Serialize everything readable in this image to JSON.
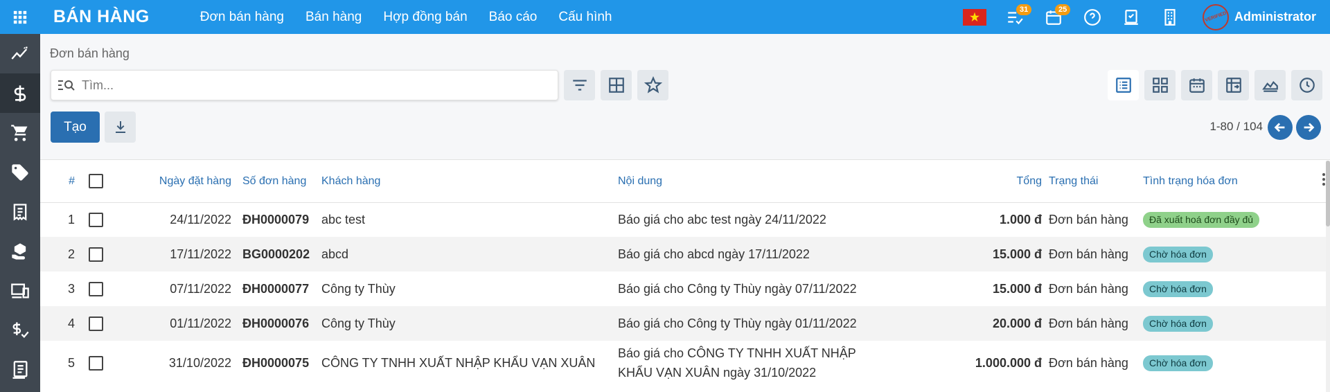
{
  "app": {
    "title": "BÁN HÀNG",
    "menu": [
      "Đơn bán hàng",
      "Bán hàng",
      "Hợp đồng bán",
      "Báo cáo",
      "Cấu hình"
    ],
    "activities_badge": "31",
    "calendar_badge": "25",
    "stamp_text": "VERIFIED",
    "user": "Administrator"
  },
  "control": {
    "breadcrumb": "Đơn bán hàng",
    "search_placeholder": "Tìm...",
    "create_label": "Tạo",
    "pager": "1-80 / 104"
  },
  "table": {
    "headers": {
      "num": "#",
      "date": "Ngày đặt hàng",
      "so": "Số đơn hàng",
      "customer": "Khách hàng",
      "content": "Nội dung",
      "total": "Tổng",
      "status": "Trạng thái",
      "invoice": "Tình trạng hóa đơn"
    },
    "rows": [
      {
        "num": "1",
        "date": "24/11/2022",
        "so": "ĐH0000079",
        "customer": "abc test",
        "content": "Báo giá cho abc test ngày 24/11/2022",
        "total": "1.000 đ",
        "status": "Đơn bán hàng",
        "invoice": "Đã xuất hoá đơn đầy đủ"
      },
      {
        "num": "2",
        "date": "17/11/2022",
        "so": "BG0000202",
        "customer": "abcd",
        "content": "Báo giá cho abcd ngày 17/11/2022",
        "total": "15.000 đ",
        "status": "Đơn bán hàng",
        "invoice": "Chờ hóa đơn"
      },
      {
        "num": "3",
        "date": "07/11/2022",
        "so": "ĐH0000077",
        "customer": "Công ty Thùy",
        "content": "Báo giá cho Công ty Thùy ngày 07/11/2022",
        "total": "15.000 đ",
        "status": "Đơn bán hàng",
        "invoice": "Chờ hóa đơn"
      },
      {
        "num": "4",
        "date": "01/11/2022",
        "so": "ĐH0000076",
        "customer": "Công ty Thùy",
        "content": "Báo giá cho Công ty Thùy ngày 01/11/2022",
        "total": "20.000 đ",
        "status": "Đơn bán hàng",
        "invoice": "Chờ hóa đơn"
      },
      {
        "num": "5",
        "date": "31/10/2022",
        "so": "ĐH0000075",
        "customer": "CÔNG TY TNHH XUẤT NHẬP KHẨU VẠN XUÂN",
        "content": "Báo giá cho CÔNG TY TNHH XUẤT NHẬP KHẨU VẠN XUÂN ngày 31/10/2022",
        "total": "1.000.000 đ",
        "status": "Đơn bán hàng",
        "invoice": "Chờ hóa đơn"
      }
    ]
  },
  "colors": {
    "topbar": "#2196e8",
    "sidebar": "#3f4750",
    "accent": "#2a6fb1",
    "pill_green": "#8fd18a",
    "pill_teal": "#7cc8d0"
  }
}
